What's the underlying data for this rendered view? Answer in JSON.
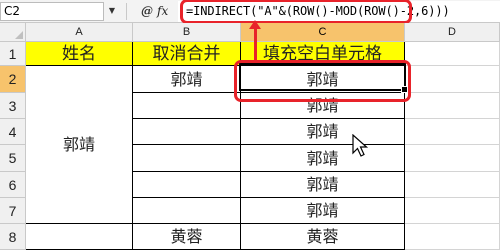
{
  "formula_bar": {
    "name_box": "C2",
    "fx_label": "fx",
    "formula": "=INDIRECT(\"A\"&(ROW()-MOD(ROW()-2,6)))"
  },
  "columns": [
    "A",
    "B",
    "C",
    "D"
  ],
  "rows": [
    "1",
    "2",
    "3",
    "4",
    "5",
    "6",
    "7",
    "8"
  ],
  "header_row": [
    "姓名",
    "取消合并",
    "填充空白单元格"
  ],
  "cells": {
    "a_merged": "郭靖",
    "b2": "郭靖",
    "b8": "黄蓉",
    "c": [
      "郭靖",
      "郭靖",
      "郭靖",
      "郭靖",
      "郭靖",
      "郭靖",
      "黄蓉"
    ]
  },
  "colors": {
    "header_fill": "#ffff00",
    "highlight": "#e8232a",
    "selected_header": "#f7c36c"
  }
}
